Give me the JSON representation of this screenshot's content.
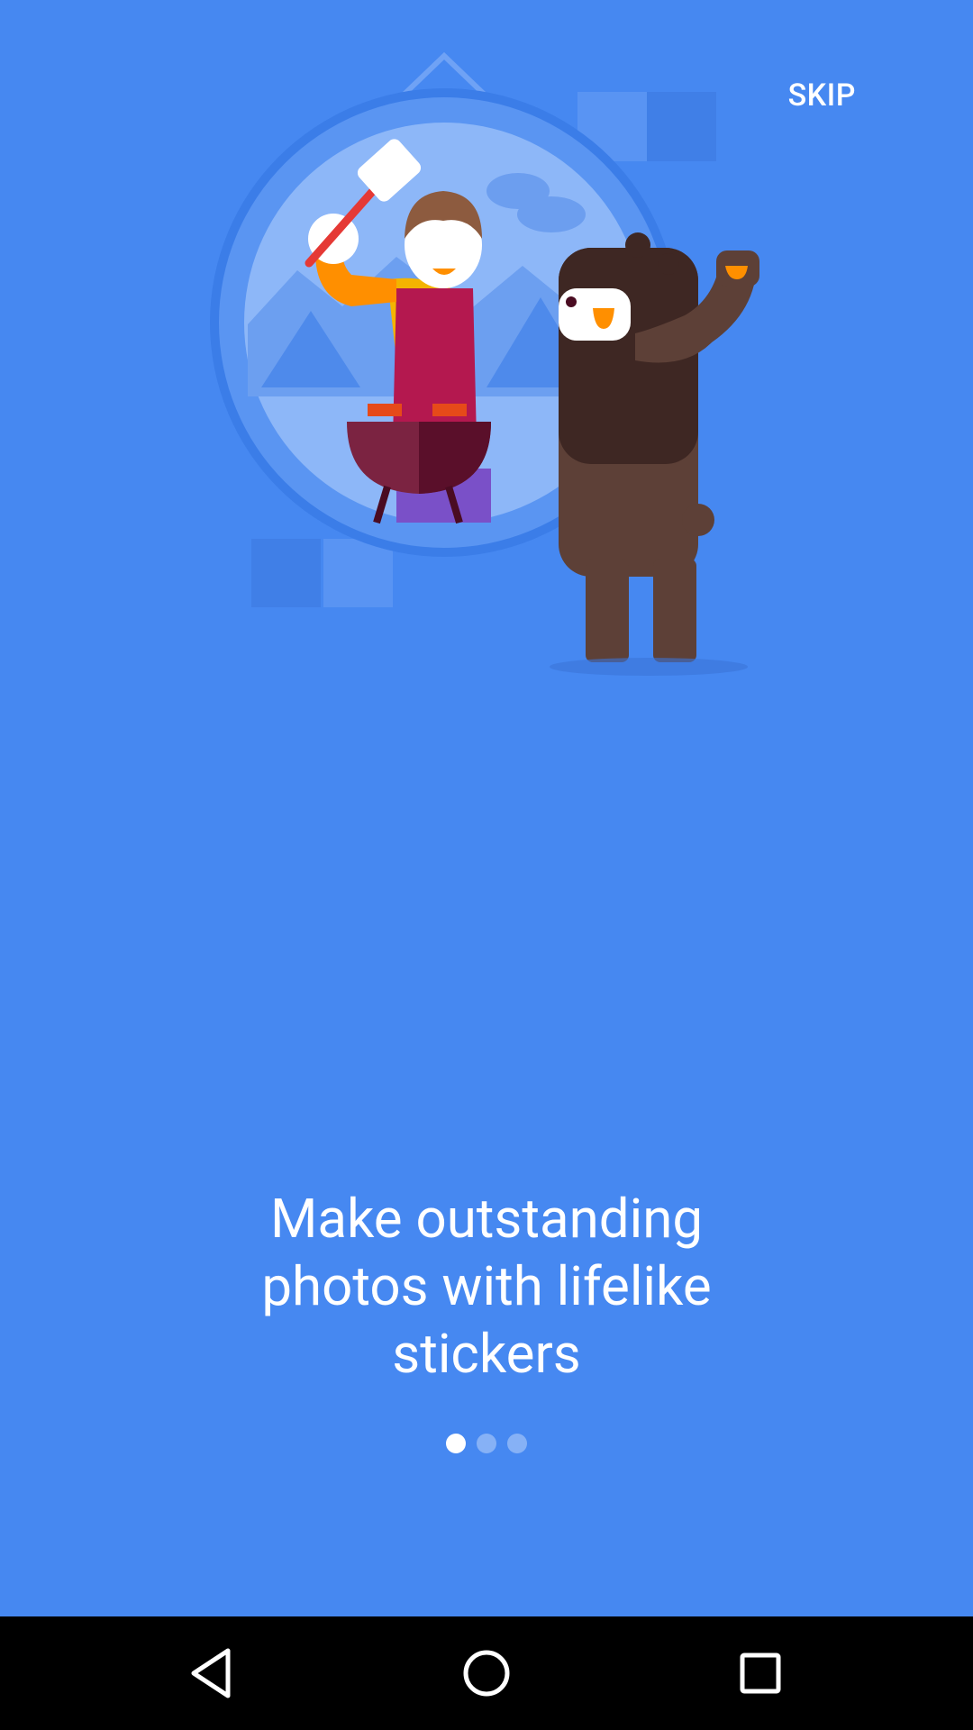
{
  "skip_label": "SKIP",
  "headline": {
    "line1": "Make outstanding",
    "line2": "photos with lifelike",
    "line3": "stickers"
  },
  "pager": {
    "total": 3,
    "current": 1
  },
  "colors": {
    "background": "#4688F1",
    "text": "#FFFFFF",
    "navbar": "#000000"
  },
  "icons": {
    "nav_back": "back-triangle-icon",
    "nav_home": "home-circle-icon",
    "nav_recent": "recent-square-icon"
  }
}
